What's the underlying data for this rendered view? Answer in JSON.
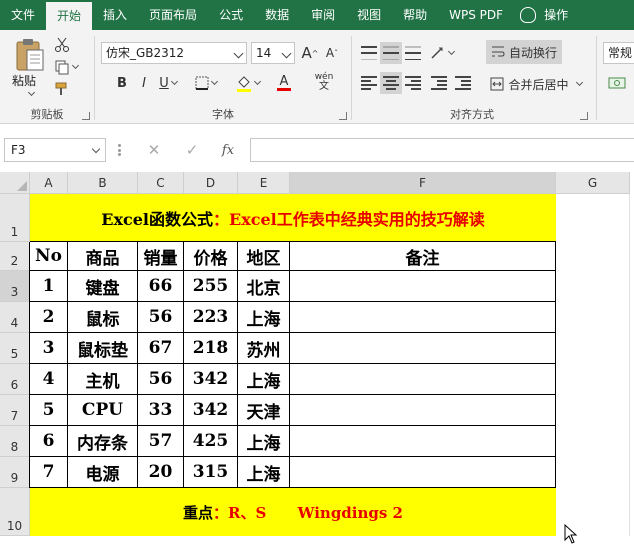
{
  "tabs": [
    {
      "label": "文件",
      "active": false
    },
    {
      "label": "开始",
      "active": true
    },
    {
      "label": "插入",
      "active": false
    },
    {
      "label": "页面布局",
      "active": false
    },
    {
      "label": "公式",
      "active": false
    },
    {
      "label": "数据",
      "active": false
    },
    {
      "label": "审阅",
      "active": false
    },
    {
      "label": "视图",
      "active": false
    },
    {
      "label": "帮助",
      "active": false
    },
    {
      "label": "WPS PDF",
      "active": false
    },
    {
      "label": "操作",
      "active": false
    }
  ],
  "ribbon": {
    "clipboard": {
      "paste_label": "粘贴",
      "group_label": "剪贴板"
    },
    "font": {
      "font_name": "仿宋_GB2312",
      "font_size": "14",
      "bold": "B",
      "italic": "I",
      "underline": "U",
      "grow": "A",
      "shrink": "A",
      "font_color_letter": "A",
      "wen": "wén",
      "group_label": "字体"
    },
    "alignment": {
      "wrap_label": "自动换行",
      "merge_label": "合并后居中",
      "group_label": "对齐方式"
    },
    "number": {
      "format_value": "常规"
    }
  },
  "formula_bar": {
    "name_box": "F3",
    "cancel": "✕",
    "confirm": "✓",
    "fx": "fx",
    "formula": ""
  },
  "sheet": {
    "columns": [
      "A",
      "B",
      "C",
      "D",
      "E",
      "F",
      "G"
    ],
    "rows": [
      "1",
      "2",
      "3",
      "4",
      "5",
      "6",
      "7",
      "8",
      "9",
      "10"
    ],
    "active_cell": "F3",
    "title_black": "Excel函数公式",
    "title_red": "：Excel工作表中经典实用的技巧解读",
    "headers": [
      "No",
      "商品",
      "销量",
      "价格",
      "地区",
      "备注"
    ],
    "data": [
      [
        "1",
        "键盘",
        "66",
        "255",
        "北京",
        ""
      ],
      [
        "2",
        "鼠标",
        "56",
        "223",
        "上海",
        ""
      ],
      [
        "3",
        "鼠标垫",
        "67",
        "218",
        "苏州",
        ""
      ],
      [
        "4",
        "主机",
        "56",
        "342",
        "上海",
        ""
      ],
      [
        "5",
        "CPU",
        "33",
        "342",
        "天津",
        ""
      ],
      [
        "6",
        "内存条",
        "57",
        "425",
        "上海",
        ""
      ],
      [
        "7",
        "电源",
        "20",
        "315",
        "上海",
        ""
      ]
    ],
    "note_black": "重点",
    "note_red": "：R、S      Wingdings 2"
  },
  "colors": {
    "ribbon_green": "#217346",
    "highlight_yellow": "#ffff00",
    "accent_red": "#e60000"
  }
}
